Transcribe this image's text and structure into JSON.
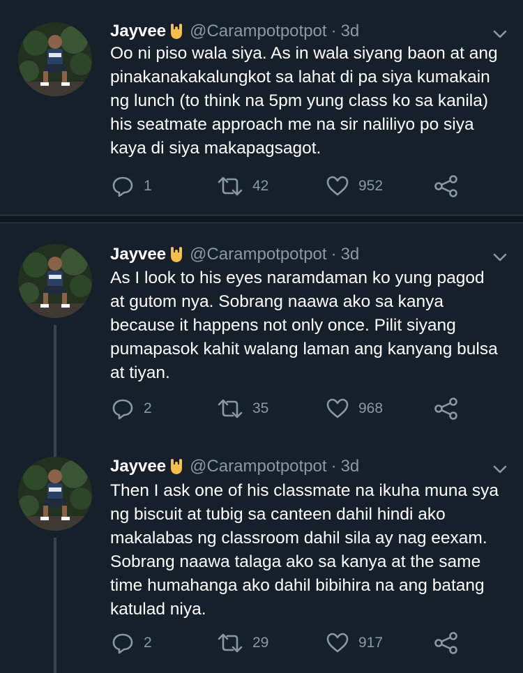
{
  "tweets": [
    {
      "author": "Jayvee",
      "handle": "@Carampotpotpot",
      "dot": "·",
      "time": "3d",
      "lines": [
        "Oo ni piso wala siya. As in wala siyang baon at ang",
        "pinakanakakalungkot sa lahat di pa siya kumakain",
        "ng lunch (to think na 5pm yung class ko sa kanila)",
        "his seatmate approach me na sir naliliyo po siya",
        "kaya di siya makapagsagot."
      ],
      "replies": "1",
      "retweets": "42",
      "likes": "952"
    },
    {
      "author": "Jayvee",
      "handle": "@Carampotpotpot",
      "dot": "·",
      "time": "3d",
      "lines": [
        "As I look to his eyes naramdaman ko yung pagod",
        "at gutom nya. Sobrang naawa ako sa kanya",
        "because it happens not only once. Pilit siyang",
        "pumapasok kahit walang laman ang kanyang bulsa",
        "at tiyan."
      ],
      "replies": "2",
      "retweets": "35",
      "likes": "968"
    },
    {
      "author": "Jayvee",
      "handle": "@Carampotpotpot",
      "dot": "·",
      "time": "3d",
      "lines": [
        "Then I ask one of his classmate na ikuha muna sya",
        "ng biscuit at tubig sa canteen dahil hindi ako",
        "makalabas ng classroom dahil sila ay nag eexam.",
        "Sobrang naawa talaga ako sa kanya at the same",
        "time humahanga ako dahil bibihira na ang batang",
        "katulad niya."
      ],
      "replies": "2",
      "retweets": "29",
      "likes": "917"
    }
  ],
  "icons": {
    "badge": "hand-rock-icon",
    "reply": "reply-icon",
    "retweet": "retweet-icon",
    "like": "heart-icon",
    "share": "share-icon",
    "menu": "chevron-down-icon"
  },
  "colors": {
    "background": "#15202b",
    "muted": "#8899a6",
    "text": "#ffffff",
    "badge": "#f5c04a"
  }
}
